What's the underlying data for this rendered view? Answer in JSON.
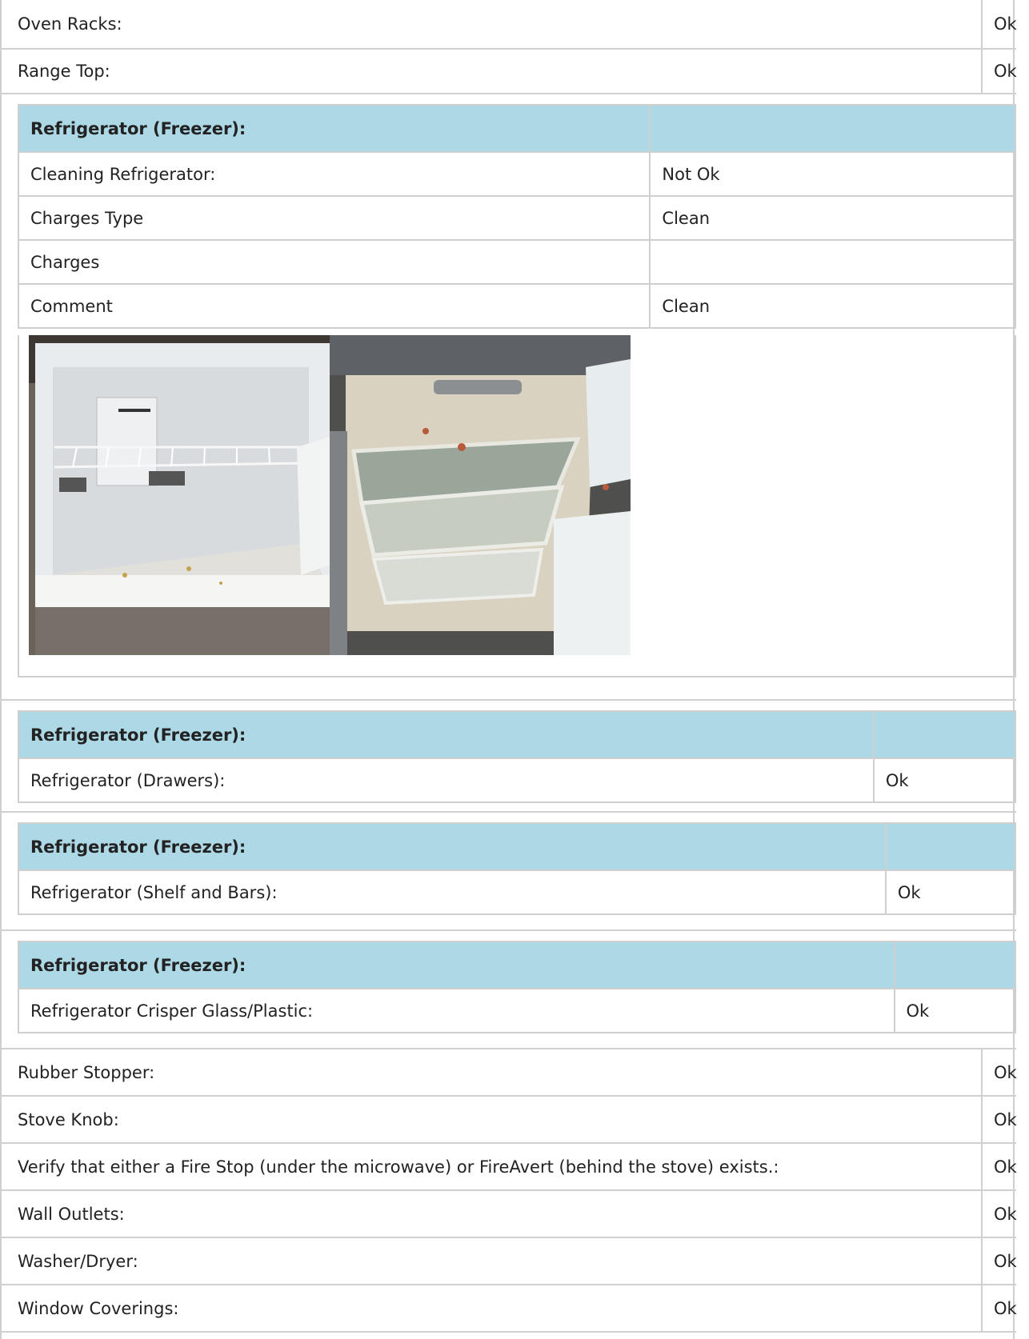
{
  "top_rows": [
    {
      "label": "Oven Racks:",
      "value": "Ok"
    },
    {
      "label": "Range Top:",
      "value": "Ok"
    }
  ],
  "fridge_main": {
    "header": "Refrigerator (Freezer):",
    "rows": [
      {
        "label": "Cleaning Refrigerator:",
        "value": "Not Ok"
      },
      {
        "label": "Charges Type",
        "value": "Clean"
      },
      {
        "label": "Charges",
        "value": ""
      },
      {
        "label": "Comment",
        "value": "Clean"
      }
    ]
  },
  "fridge_drawers": {
    "header": "Refrigerator (Freezer):",
    "label": "Refrigerator (Drawers):",
    "value": "Ok"
  },
  "fridge_shelf": {
    "header": "Refrigerator (Freezer):",
    "label": "Refrigerator (Shelf and Bars):",
    "value": "Ok"
  },
  "fridge_crisper": {
    "header": "Refrigerator (Freezer):",
    "label": "Refrigerator Crisper Glass/Plastic:",
    "value": "Ok"
  },
  "bottom_rows": [
    {
      "label": "Rubber Stopper:",
      "value": "Ok"
    },
    {
      "label": "Stove Knob:",
      "value": "Ok"
    },
    {
      "label": "Verify that either a Fire Stop (under the microwave) or FireAvert (behind the stove) exists.:",
      "value": "Ok"
    },
    {
      "label": "Wall Outlets:",
      "value": "Ok"
    },
    {
      "label": "Washer/Dryer:",
      "value": "Ok"
    },
    {
      "label": "Window Coverings:",
      "value": "Ok"
    }
  ]
}
